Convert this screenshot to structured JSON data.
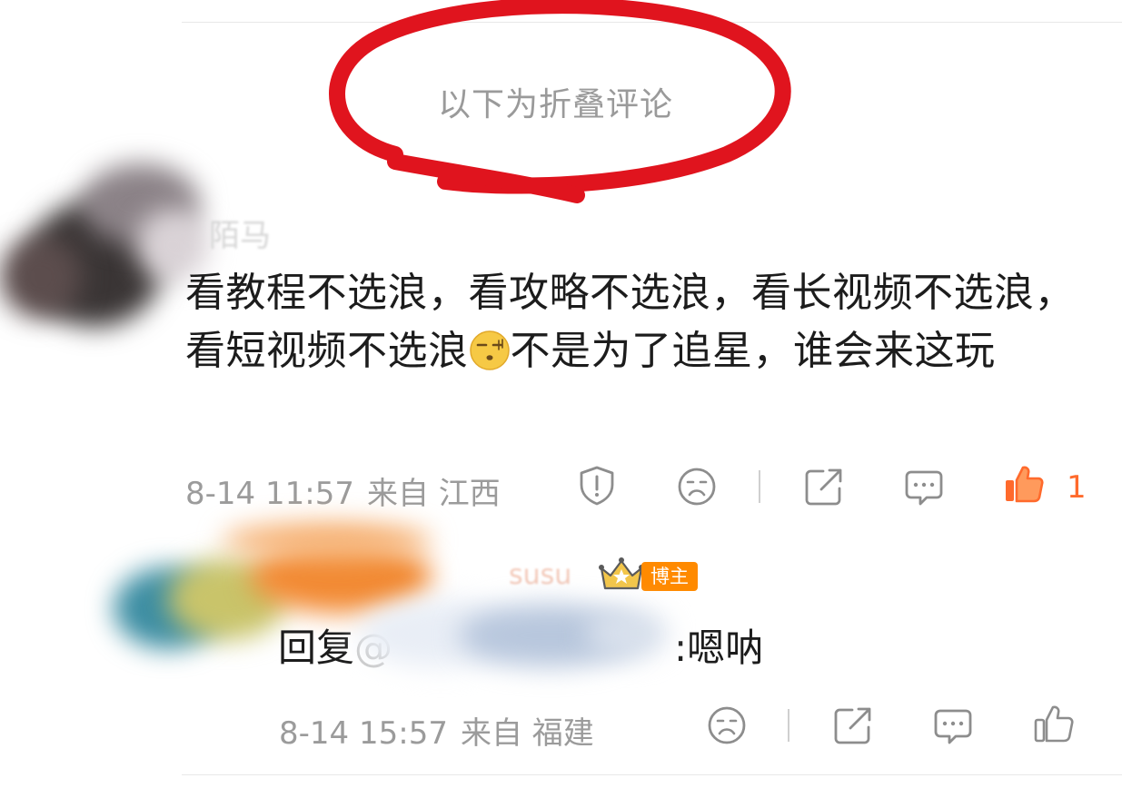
{
  "folded_section": {
    "label": "以下为折叠评论"
  },
  "comment": {
    "author_name_partial": "陌马",
    "text_part1": "看教程不选浪，看攻略不选浪，看长视频不选浪，看短视频不选浪",
    "text_part2": "不是为了追星，谁会来这玩",
    "emoji": "sleepy-face-emoji",
    "date": "8-14 11:57",
    "source": "来自 江西",
    "actions": {
      "report": "shield-exclamation-icon",
      "dislike": "frown-icon",
      "share": "share-icon",
      "comment": "comment-icon",
      "like": "thumbs-up-icon"
    },
    "like_count": "1",
    "like_color": "#ff6a2c"
  },
  "reply": {
    "author_name_partial": "susu",
    "badge": "博主",
    "badge_color": "#ff8a00",
    "prefix": "回复",
    "mention_partial": "@",
    "text": ":嗯呐",
    "date": "8-14 15:57",
    "source": "来自 福建",
    "actions": {
      "dislike": "frown-icon",
      "share": "share-icon",
      "comment": "comment-icon",
      "like": "thumbs-up-icon"
    }
  },
  "annotation_color": "#e0141e"
}
